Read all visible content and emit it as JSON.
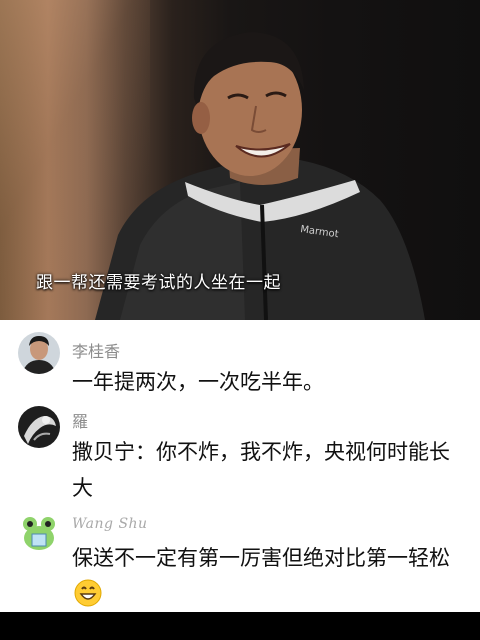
{
  "video": {
    "subtitle": "跟一帮还需要考试的人坐在一起",
    "jacket_brand": "Marmot"
  },
  "comments": [
    {
      "username": "李桂香",
      "text": "一年提两次，一次吃半年。"
    },
    {
      "username": "羅",
      "text": "撒贝宁：你不炸，我不炸，央视何时能长大"
    },
    {
      "username": "Wang Shu",
      "text": "保送不一定有第一厉害但绝对比第一轻松",
      "emoji": "grinning-face-emoji"
    }
  ],
  "colors": {
    "username": "#8c8c8c",
    "text": "#111111",
    "background": "#ffffff"
  }
}
